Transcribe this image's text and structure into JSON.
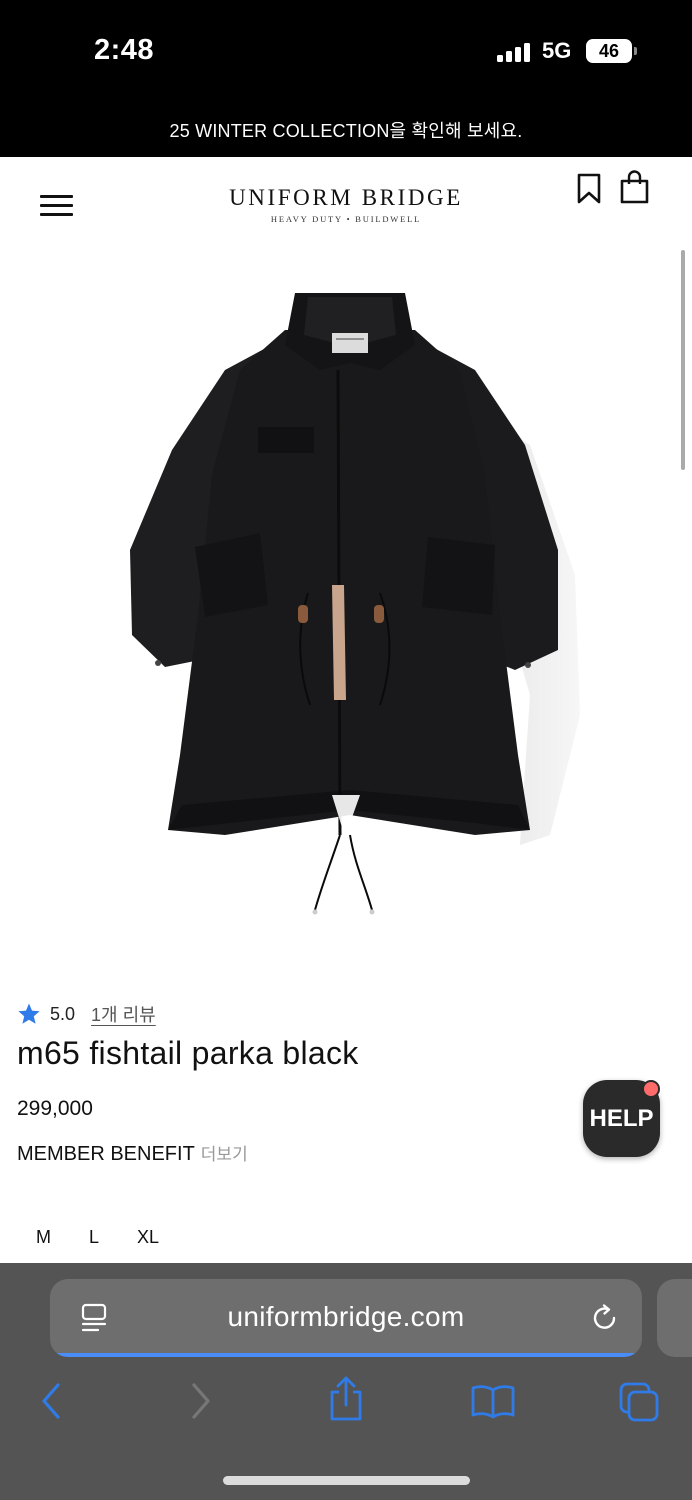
{
  "status_bar": {
    "time": "2:48",
    "network": "5G",
    "battery": "46"
  },
  "promo": {
    "text": "25 WINTER COLLECTION을 확인해 보세요."
  },
  "header": {
    "logo_main": "UNIFORM BRIDGE",
    "logo_sub": "HEAVY DUTY • BUILDWELL",
    "icons": [
      "menu-icon",
      "bookmark-icon",
      "shopping-bag-icon"
    ]
  },
  "product": {
    "image_alt": "black m65 fishtail parka",
    "rating": "5.0",
    "review_link": "1개 리뷰",
    "title": "m65 fishtail parka black",
    "price": "299,000",
    "member_benefit": "MEMBER BENEFIT",
    "member_more": "더보기",
    "sizes": [
      "M",
      "L",
      "XL"
    ]
  },
  "help_button": {
    "label": "HELP"
  },
  "browser": {
    "url": "uniformbridge.com",
    "icons": [
      "reader-icon",
      "reload-icon",
      "back-icon",
      "forward-icon",
      "share-icon",
      "bookmarks-icon",
      "tabs-icon"
    ]
  },
  "colors": {
    "accent_blue": "#2f7be8",
    "url_progress": "#4b8df8",
    "help_dot": "#ff6b6b"
  }
}
